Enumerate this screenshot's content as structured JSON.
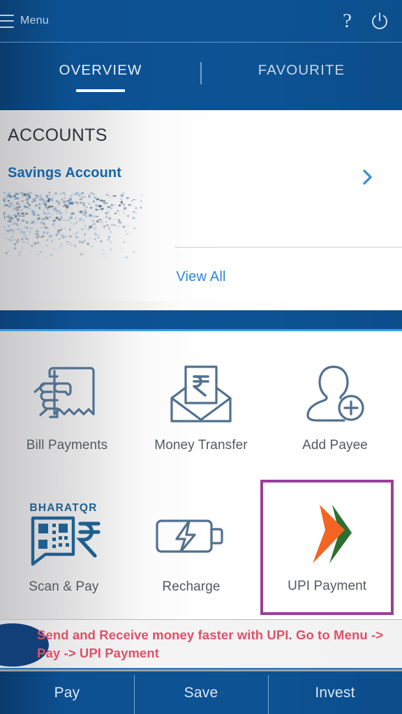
{
  "topbar": {
    "menu_label": "Menu",
    "menu_icon": "hamburger-menu-icon",
    "help_icon": "?",
    "help_icon_name": "help-question-icon",
    "power_icon_name": "power-logout-icon"
  },
  "tabs": [
    {
      "label": "OVERVIEW",
      "active": true
    },
    {
      "label": "FAVOURITE",
      "active": false
    }
  ],
  "accounts": {
    "section_title": "ACCOUNTS",
    "account_name": "Savings Account",
    "account_detail_redacted": true,
    "chevron_icon": "chevron-right-icon",
    "view_all_label": "View All"
  },
  "services": [
    [
      {
        "label": "Bill Payments",
        "icon": "hand-receipt-icon",
        "highlighted": false
      },
      {
        "label": "Money Transfer",
        "icon": "envelope-rupee-icon",
        "highlighted": false
      },
      {
        "label": "Add Payee",
        "icon": "person-plus-icon",
        "highlighted": false
      }
    ],
    [
      {
        "label": "Scan & Pay",
        "icon": "bharatqr-icon",
        "brand_text": "BHARATQR",
        "highlighted": false
      },
      {
        "label": "Recharge",
        "icon": "battery-bolt-icon",
        "highlighted": false
      },
      {
        "label": "UPI Payment",
        "icon": "upi-logo-icon",
        "highlighted": true
      }
    ]
  ],
  "notice": {
    "text": "Send and Receive money faster with UPI. Go to Menu -> Pay -> UPI Payment",
    "indicator_name": "notification-indicator"
  },
  "bottom_nav": [
    {
      "label": "Pay"
    },
    {
      "label": "Save"
    },
    {
      "label": "Invest"
    }
  ],
  "colors": {
    "brand_blue": "#0d5394",
    "dark_blue": "#0a3b6c",
    "link_blue": "#2b86d6",
    "account_blue": "#1464a5",
    "highlight_purple": "#9b3d9b",
    "notice_red": "#e0506a",
    "icon_outline": "#51708e",
    "bharatqr_blue": "#1f5f8f",
    "upi_orange": "#f26522",
    "upi_green": "#2b7031"
  }
}
